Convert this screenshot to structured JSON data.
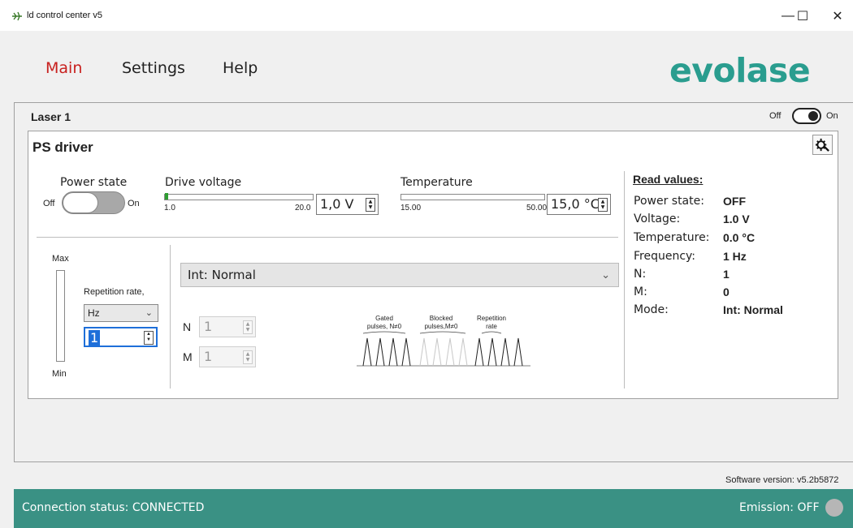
{
  "window": {
    "title": "ld control center v5",
    "controls": {
      "minimize": "—",
      "maximize": "☐",
      "close": "✕"
    },
    "icon": "app-icon"
  },
  "menu": {
    "main": "Main",
    "settings": "Settings",
    "help": "Help",
    "active": "Main"
  },
  "brand": {
    "logo_text": "evolase",
    "color": "#2a9d8f"
  },
  "laser": {
    "title": "Laser 1",
    "toggle_off": "Off",
    "toggle_on": "On",
    "state": "On"
  },
  "driver": {
    "title": "PS driver",
    "settings_icon": "gear-icon",
    "power_state": {
      "label": "Power state",
      "off": "Off",
      "on": "On",
      "value": "Off"
    },
    "drive_voltage": {
      "label": "Drive voltage",
      "min": "1.0",
      "max": "20.0",
      "value": "1,0 V",
      "fill_fraction": 0.0
    },
    "temperature": {
      "label": "Temperature",
      "min": "15.00",
      "max": "50.00",
      "value": "15,0 °C",
      "fill_fraction": 0.0
    },
    "level": {
      "max": "Max",
      "min": "Min"
    },
    "repetition": {
      "label": "Repetition rate,",
      "unit": "Hz",
      "value": "1"
    },
    "mode": {
      "selected": "Int: Normal"
    },
    "n": {
      "label": "N",
      "value": "1"
    },
    "m": {
      "label": "M",
      "value": "1"
    },
    "diagram": {
      "gated": [
        "Gated",
        "pulses, N≠0"
      ],
      "blocked": [
        "Blocked",
        "pulses,M≠0"
      ],
      "rep": [
        "Repetition",
        "rate"
      ]
    }
  },
  "read_values": {
    "title": "Read values:",
    "rows": [
      {
        "key": "Power state:",
        "value": "OFF"
      },
      {
        "key": "Voltage:",
        "value": "1.0 V"
      },
      {
        "key": "Temperature:",
        "value": "0.0 °C"
      },
      {
        "key": "Frequency:",
        "value": "1 Hz"
      },
      {
        "key": "N:",
        "value": "1"
      },
      {
        "key": "M:",
        "value": "0"
      },
      {
        "key": "Mode:",
        "value": "Int: Normal"
      }
    ]
  },
  "software_version": "Software version:  v5.2b5872",
  "status": {
    "connection": "Connection status: CONNECTED",
    "emission": "Emission: OFF",
    "bar_color": "#3a9184"
  }
}
